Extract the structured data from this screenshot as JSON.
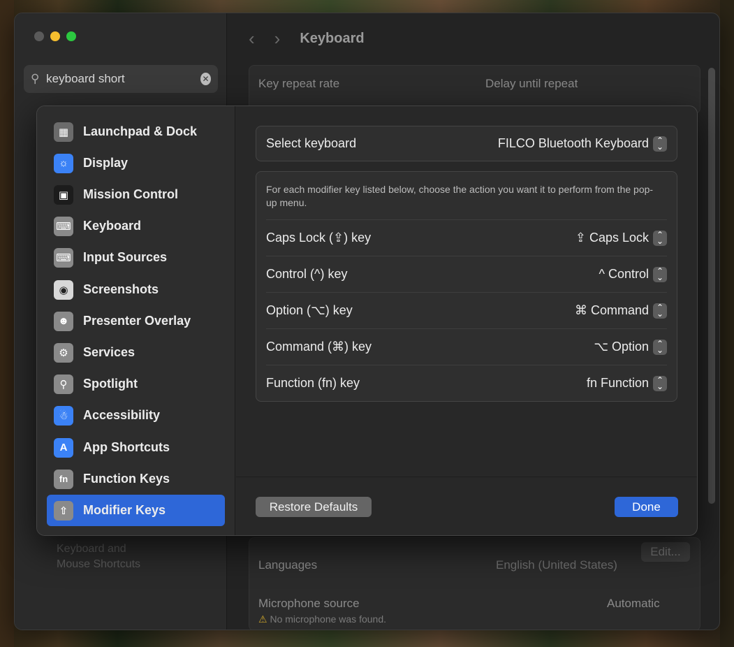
{
  "window": {
    "search_value": "keyboard short",
    "title": "Keyboard",
    "sidebar_bottom": "Keyboard and Mouse Shortcuts"
  },
  "background_settings": {
    "key_repeat_rate": "Key repeat rate",
    "delay_until_repeat": "Delay until repeat",
    "languages": "Languages",
    "languages_value": "English (United States)",
    "edit_label": "Edit...",
    "microphone_source": "Microphone source",
    "microphone_value": "Automatic",
    "microphone_warning": "No microphone was found."
  },
  "sheet": {
    "sidebar": [
      {
        "label": "Launchpad & Dock",
        "icon": "launchpad-icon"
      },
      {
        "label": "Display",
        "icon": "display-icon"
      },
      {
        "label": "Mission Control",
        "icon": "mission-control-icon"
      },
      {
        "label": "Keyboard",
        "icon": "keyboard-icon"
      },
      {
        "label": "Input Sources",
        "icon": "input-sources-icon"
      },
      {
        "label": "Screenshots",
        "icon": "screenshots-icon"
      },
      {
        "label": "Presenter Overlay",
        "icon": "presenter-overlay-icon"
      },
      {
        "label": "Services",
        "icon": "services-icon"
      },
      {
        "label": "Spotlight",
        "icon": "spotlight-icon"
      },
      {
        "label": "Accessibility",
        "icon": "accessibility-icon"
      },
      {
        "label": "App Shortcuts",
        "icon": "app-shortcuts-icon"
      },
      {
        "label": "Function Keys",
        "icon": "function-keys-icon"
      },
      {
        "label": "Modifier Keys",
        "icon": "modifier-keys-icon",
        "selected": true
      }
    ],
    "select_keyboard_label": "Select keyboard",
    "select_keyboard_value": "FILCO Bluetooth Keyboard",
    "description": "For each modifier key listed below, choose the action you want it to perform from the pop-up menu.",
    "modifiers": [
      {
        "key": "Caps Lock (⇪) key",
        "value": "⇪ Caps Lock"
      },
      {
        "key": "Control (^) key",
        "value": "^ Control"
      },
      {
        "key": "Option (⌥) key",
        "value": "⌘ Command"
      },
      {
        "key": "Command (⌘) key",
        "value": "⌥ Option"
      },
      {
        "key": "Function (fn) key",
        "value": "fn Function"
      }
    ],
    "restore_defaults": "Restore Defaults",
    "done": "Done"
  },
  "colors": {
    "accent": "#2e67d8",
    "window_bg": "#232323",
    "sheet_bg": "#282828"
  }
}
